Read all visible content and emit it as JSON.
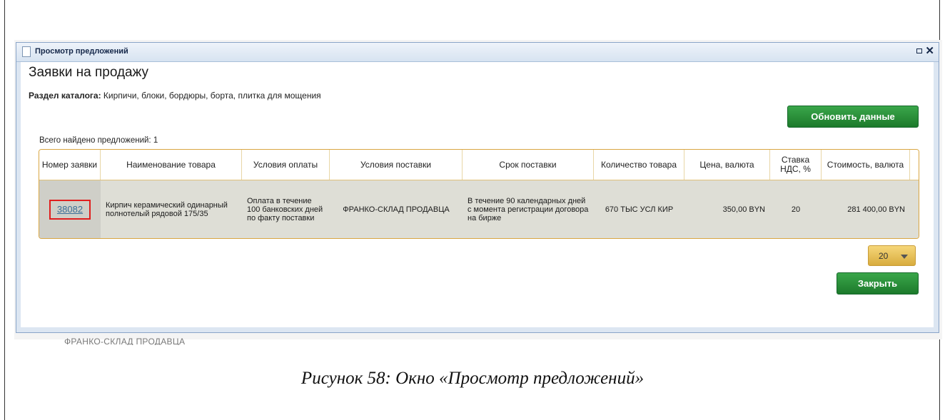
{
  "window": {
    "title": "Просмотр предложений"
  },
  "page": {
    "heading": "Заявки на продажу",
    "catalog_label": "Раздел каталога:",
    "catalog_value": " Кирпичи, блоки, бордюры, борта, плитка для мощения",
    "refresh_button": "Обновить данные",
    "found_text": "Всего найдено предложений: 1",
    "close_button": "Закрыть",
    "page_size": "20"
  },
  "table": {
    "headers": [
      "Номер заявки",
      "Наименование товара",
      "Условия оплаты",
      "Условия поставки",
      "Срок поставки",
      "Количество товара",
      "Цена, валюта",
      "Ставка НДС, %",
      "Стоимость, валюта"
    ],
    "rows": [
      {
        "number": "38082",
        "product": "Кирпич керамический одинарный полнотелый рядовой 175/35",
        "payment": "Оплата в течение 100 банковских дней по факту поставки",
        "delivery": "ФРАНКО-СКЛАД ПРОДАВЦА",
        "term": "В течение 90 календарных дней с момента регистрации договора на бирже",
        "quantity": "670 ТЫС УСЛ КИР",
        "price": "350,00 BYN",
        "vat": "20",
        "cost": "281 400,00 BYN"
      }
    ]
  },
  "background_text": "ФРАНКО-СКЛАД ПРОДАВЦА",
  "caption": "Рисунок 58: Окно «Просмотр предложений»"
}
